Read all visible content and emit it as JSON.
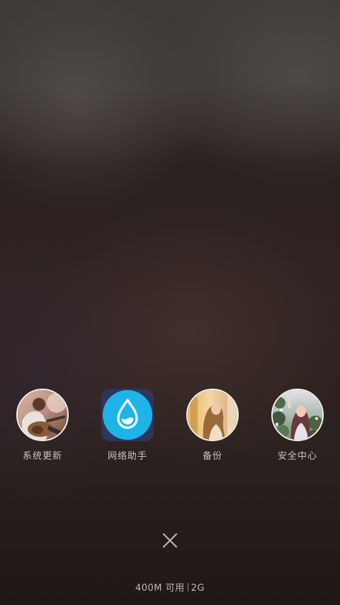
{
  "recent_apps": [
    {
      "label": "系统更新",
      "icon": "guitar-photo-icon"
    },
    {
      "label": "网络助手",
      "icon": "water-drop-icon"
    },
    {
      "label": "备份",
      "icon": "girl-photo-icon"
    },
    {
      "label": "安全中心",
      "icon": "flower-girl-photo-icon"
    }
  ],
  "close": {
    "icon": "close-icon"
  },
  "memory": {
    "available": "400M 可用",
    "total": "2G"
  },
  "colors": {
    "accent_blue": "#1db4ea",
    "icon_bg": "#2f3559",
    "label_text": "#c9c4c0"
  }
}
